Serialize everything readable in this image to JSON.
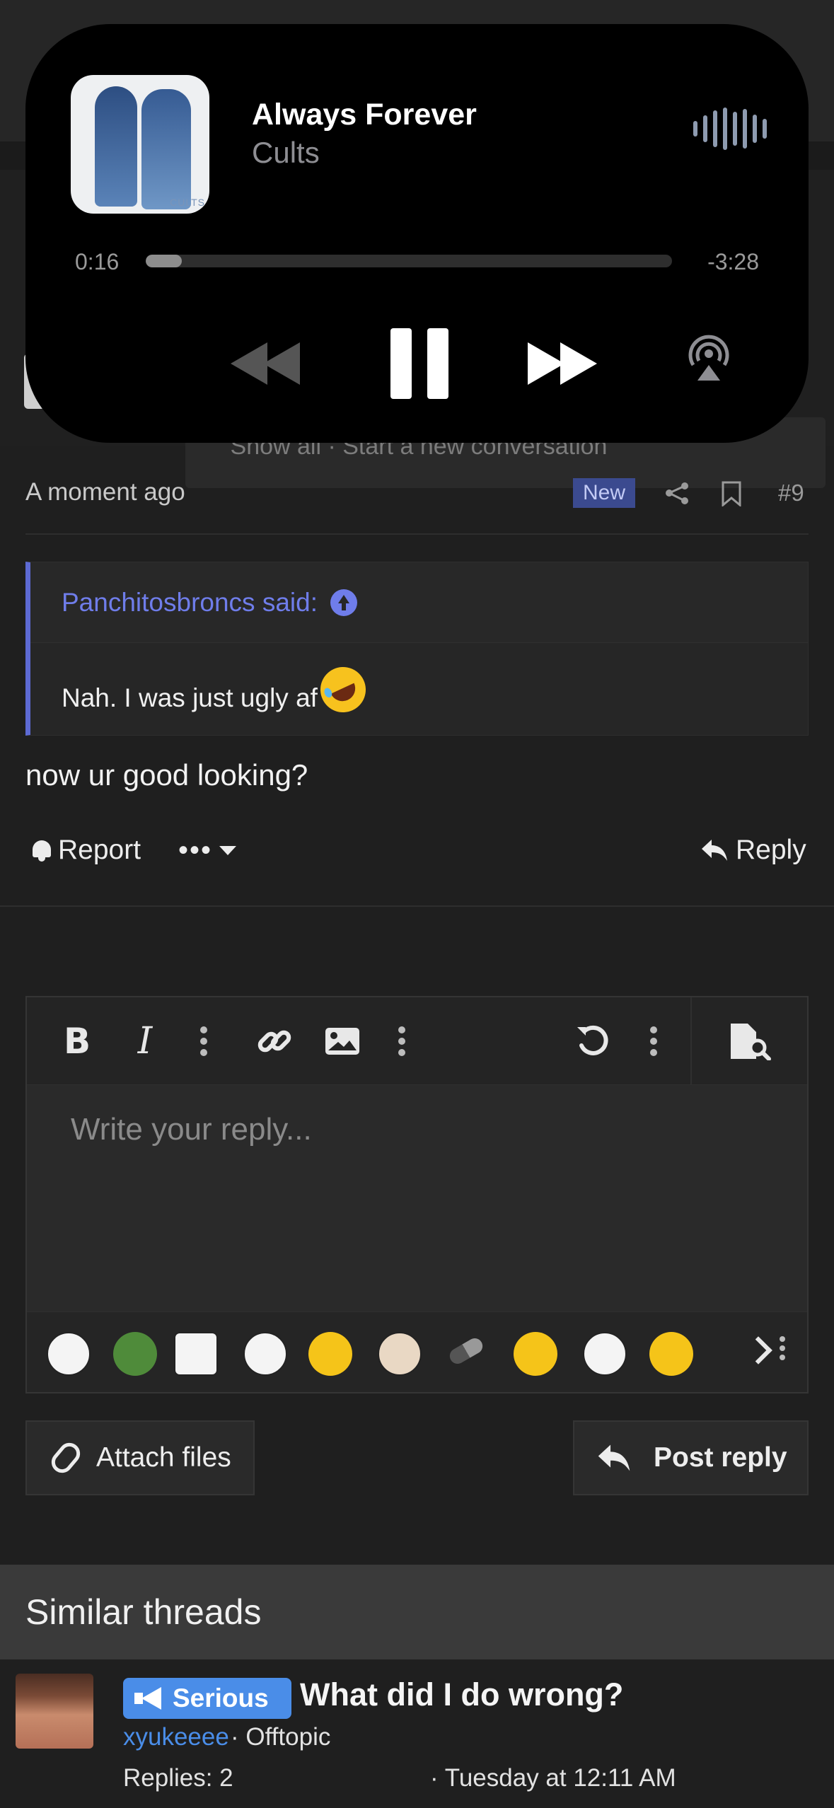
{
  "now_playing": {
    "title": "Always Forever",
    "artist": "Cults",
    "album_art_text": "CULTS",
    "elapsed": "0:16",
    "remaining": "-3:28",
    "progress": 0.068
  },
  "background_menu": {
    "text": "Show all · Start a new conversation"
  },
  "post": {
    "time": "A moment ago",
    "new_badge": "New",
    "post_number": "#9",
    "quote": {
      "author_line": "Panchitosbroncs said:",
      "text": "Nah. I was just ugly af"
    },
    "body": "now ur good looking?",
    "actions": {
      "report": "Report",
      "more": "•••",
      "reply": "Reply"
    }
  },
  "editor": {
    "placeholder": "Write your reply...",
    "toolbar": {
      "bold": "B",
      "italic": "I"
    },
    "emojis": [
      "wojak-crying",
      "pepe-police",
      "wojak-lying",
      "wojak-smile",
      "unamused",
      "wojak-horse",
      "pill",
      "wink",
      "wojak-cry",
      "tongue"
    ]
  },
  "buttons": {
    "attach": "Attach files",
    "post_reply": "Post reply"
  },
  "similar": {
    "heading": "Similar threads",
    "thread": {
      "prefix": "Serious",
      "title": "What did I do wrong?",
      "author": "xyukeeee",
      "forum": "· Offtopic",
      "replies": "Replies: 2",
      "date": "· Tuesday at 12:11 AM"
    }
  },
  "colors": {
    "accent": "#6f7dea",
    "link": "#4a8de8",
    "badge_new": "#3b4a8f",
    "background": "#1f1f1f"
  }
}
